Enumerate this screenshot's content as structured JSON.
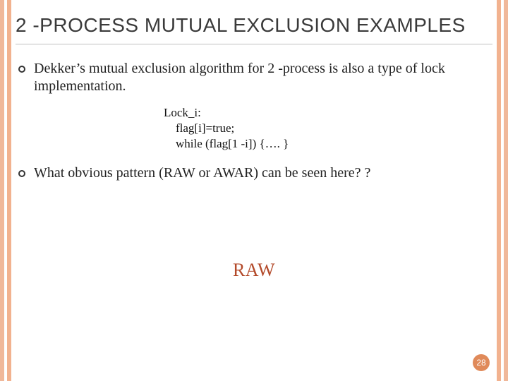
{
  "title": "2 -PROCESS MUTUAL EXCLUSION EXAMPLES",
  "bullets": [
    "Dekker’s mutual exclusion algorithm for 2 -process is also a type of lock implementation.",
    "What obvious pattern (RAW or AWAR) can be seen here? ?"
  ],
  "code": "Lock_i:\n    flag[i]=true;\n    while (flag[1 -i]) {…. }",
  "answer": "RAW",
  "page_number": "28"
}
